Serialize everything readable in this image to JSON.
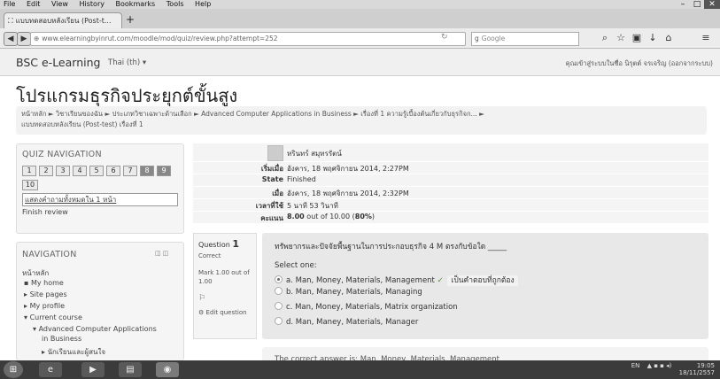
{
  "browser": {
    "menu": [
      "File",
      "Edit",
      "View",
      "History",
      "Bookmarks",
      "Tools",
      "Help"
    ],
    "tab_title": "แบบทดสอบหลังเรียน (Post-t...",
    "new_tab": "+",
    "url": "www.elearningbyinrut.com/moodle/mod/quiz/review.php?attempt=252",
    "search_placeholder": "Google",
    "window_controls": [
      "–",
      "□",
      "✕"
    ]
  },
  "site": {
    "name": "BSC e-Learning",
    "language": "Thai (th) ▾",
    "login_info": "คุณเข้าสู่ระบบในชื่อ นิรุตต์ จรเจริญ (ออกจากระบบ)"
  },
  "page_title": "โปรแกรมธุรกิจประยุกต์ขั้นสูง",
  "breadcrumb": {
    "line1": "หน้าหลัก  ►  วิชาเรียนของฉัน  ►  ประเภทวิชาเฉพาะด้านเลือก  ►  Advanced Computer Applications in Business  ►  เรื่องที่ 1 ความรู้เบื้องต้นเกี่ยวกับธุรกิจก...  ►",
    "line2": "แบบทดสอบหลังเรียน (Post-test) เรื่องที่ 1"
  },
  "quiz_nav": {
    "title": "QUIZ NAVIGATION",
    "numbers": [
      "1",
      "2",
      "3",
      "4",
      "5",
      "6",
      "7",
      "8",
      "9",
      "10"
    ],
    "show_all": "แสดงคำถามทั้งหมดใน 1 หน้า",
    "finish": "Finish review"
  },
  "navigation": {
    "title": "NAVIGATION",
    "home": "หน้าหลัก",
    "items": [
      "My home",
      "Site pages",
      "My profile",
      "Current course",
      "Advanced Computer Applications",
      "in Business",
      "นักเรียนและผู้สนใจ"
    ]
  },
  "summary": {
    "user": "หรินทร์ สมุทรรัตน์",
    "rows": [
      {
        "label": "เริ่มเมื่อ",
        "value": "อังคาร, 18 พฤศจิกายน 2014, 2:27PM"
      },
      {
        "label": "State",
        "value": "Finished"
      },
      {
        "label": "เมื่อ",
        "value": "อังคาร, 18 พฤศจิกายน 2014, 2:32PM"
      },
      {
        "label": "เวลาที่ใช้",
        "value": "5 นาที 53 วินาที"
      },
      {
        "label": "คะแนน",
        "value_bold": "8.00",
        "value_rest": " out of 10.00 (",
        "percent": "80%",
        "close": ")"
      }
    ]
  },
  "question": {
    "label": "Question",
    "number": "1",
    "status": "Correct",
    "mark": "Mark 1.00 out of 1.00",
    "flag_icon": "flag",
    "edit": "Edit question",
    "text": "ทรัพยากรและปัจจัยพื้นฐานในการประกอบธุรกิจ 4 M ตรงกับข้อใด _____",
    "select_one": "Select one:",
    "options": [
      "a. Man, Money, Materials, Management",
      "b. Man, Maney, Materials, Managing",
      "c. Man, Money, Materials, Matrix organization",
      "d. Man, Maney, Materials, Manager"
    ],
    "selected_index": 0,
    "correct_mark": "✓",
    "correct_note": "เป็นคำตอบที่ถูกต้อง",
    "feedback": "The correct answer is: Man, Money, Materials, Management"
  },
  "taskbar": {
    "tray_lang": "EN",
    "time": "19:05",
    "date": "18/11/2557"
  }
}
